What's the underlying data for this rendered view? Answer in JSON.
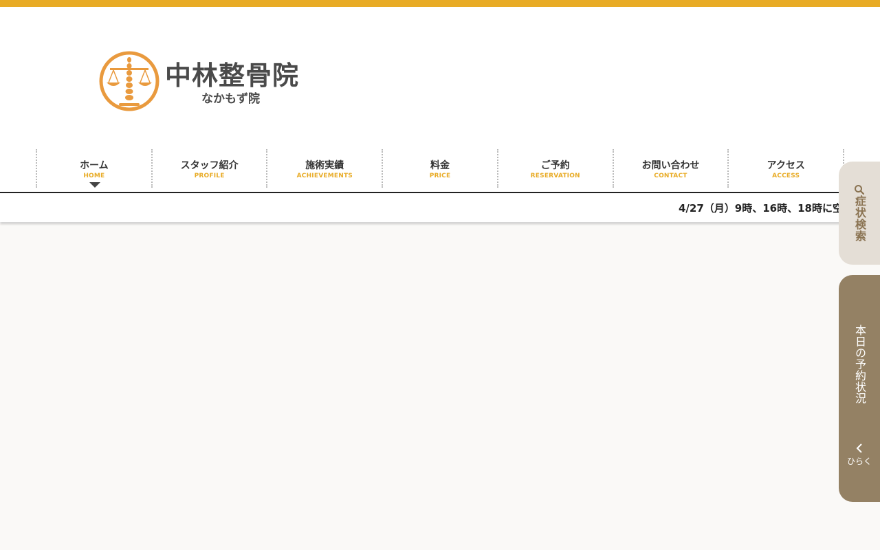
{
  "colors": {
    "accent": "#e8ab25",
    "logo_orange": "#e99a3e",
    "text_dark": "#333333",
    "search_tab_bg": "#e4ded6",
    "search_tab_text": "#8a7352",
    "reserve_tab_bg": "#948164",
    "page_bg": "#faf9f7"
  },
  "logo": {
    "title": "中林整骨院",
    "subtitle": "なかもず院",
    "mark_icon": "scales-of-justice-icon"
  },
  "nav": {
    "items": [
      {
        "label_jp": "ホーム",
        "label_en": "HOME",
        "active": true
      },
      {
        "label_jp": "スタッフ紹介",
        "label_en": "PROFILE"
      },
      {
        "label_jp": "施術実績",
        "label_en": "ACHIEVEMENTS"
      },
      {
        "label_jp": "料金",
        "label_en": "PRICE"
      },
      {
        "label_jp": "ご予約",
        "label_en": "RESERVATION"
      },
      {
        "label_jp": "お問い合わせ",
        "label_en": "CONTACT"
      },
      {
        "label_jp": "アクセス",
        "label_en": "ACCESS"
      }
    ]
  },
  "ticker": {
    "text": "4/27（月）9時、16時、18時に空"
  },
  "side_tabs": {
    "search": {
      "label": "症状検索",
      "icon": "search-icon"
    },
    "reservation": {
      "label": "本日の予約状況",
      "open_label": "ひらく",
      "open_icon": "chevron-left-icon"
    }
  }
}
